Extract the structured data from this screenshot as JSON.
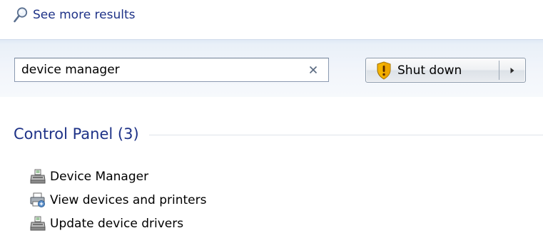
{
  "start_menu": {
    "see_more": {
      "label": "See more results",
      "icon": "search-icon"
    },
    "search": {
      "value": "device manager",
      "clear_icon": "close-icon"
    },
    "power": {
      "label": "Shut down",
      "icon": "uac-shield-icon",
      "options_icon": "chevron-right-icon"
    },
    "groups": [
      {
        "title": "Control Panel (3)",
        "items": [
          {
            "label": "Device Manager",
            "icon": "device-manager-icon"
          },
          {
            "label": "View devices and printers",
            "icon": "printer-icon"
          },
          {
            "label": "Update device drivers",
            "icon": "device-manager-icon"
          }
        ]
      }
    ],
    "colors": {
      "link": "#1e3287",
      "band": "#eef3f9",
      "shield": "#f5b800"
    }
  }
}
